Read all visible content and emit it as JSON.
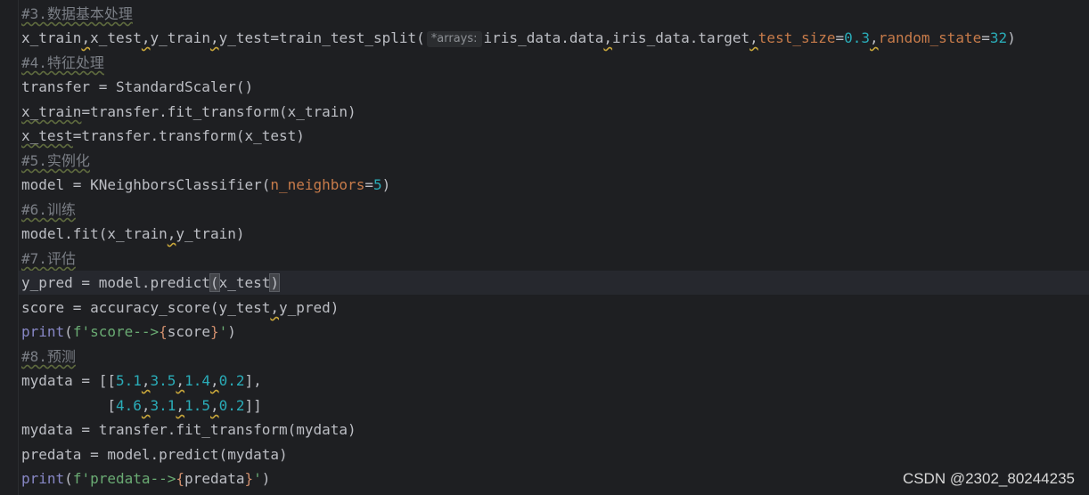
{
  "code": {
    "c3": "#3.数据基本处理",
    "l_split": {
      "a1": "x_train",
      "a2": "x_test",
      "a3": "y_train",
      "a4": "y_test=train_test_split(",
      "hint": "*arrays:",
      "a5": "iris_data.data",
      "a6": "iris_data.target",
      "p1": "test_size",
      "eq1": "=",
      "v1": "0.3",
      "p2": "random_state",
      "eq2": "=",
      "v2": "32",
      "close": ")"
    },
    "c4": "#4.特征处理",
    "l_transfer": "transfer = StandardScaler()",
    "l_xtrain": {
      "a": "x_train",
      "b": "=transfer.fit_transform(x_train)"
    },
    "l_xtest": {
      "a": "x_test",
      "b": "=transfer.transform(x_test)"
    },
    "c5": "#5.实例化",
    "l_model": {
      "a": "model = KNeighborsClassifier(",
      "p": "n_neighbors",
      "eq": "=",
      "v": "5",
      "close": ")"
    },
    "c6": "#6.训练",
    "l_fit": {
      "a": "model.fit(x_train",
      "b": "y_train)"
    },
    "c7": "#7.评估",
    "l_pred": {
      "a": "y_pred = model.predict",
      "open": "(",
      "b": "x_test",
      "close": ")"
    },
    "l_score": {
      "a": "score = accuracy_score(y_test",
      "b": "y_pred)"
    },
    "l_print1": {
      "fn": "print",
      "open": "(",
      "s1": "f'score-->",
      "lb": "{",
      "v": "score",
      "rb": "}",
      "s2": "'",
      "close": ")"
    },
    "c8": "#8.预测",
    "l_mydata1": {
      "a": "mydata = [[",
      "n1": "5.1",
      "n2": "3.5",
      "n3": "1.4",
      "n4": "0.2",
      "b": "],"
    },
    "l_mydata2": {
      "indent": "          [",
      "n1": "4.6",
      "n2": "3.1",
      "n3": "1.5",
      "n4": "0.2",
      "b": "]]"
    },
    "l_mydata3": "mydata = transfer.fit_transform(mydata)",
    "l_predata": "predata = model.predict(mydata)",
    "l_print2": {
      "fn": "print",
      "open": "(",
      "s1": "f'predata-->",
      "lb": "{",
      "v": "predata",
      "rb": "}",
      "s2": "'",
      "close": ")"
    },
    "comma": ","
  },
  "watermark": "CSDN @2302_80244235"
}
